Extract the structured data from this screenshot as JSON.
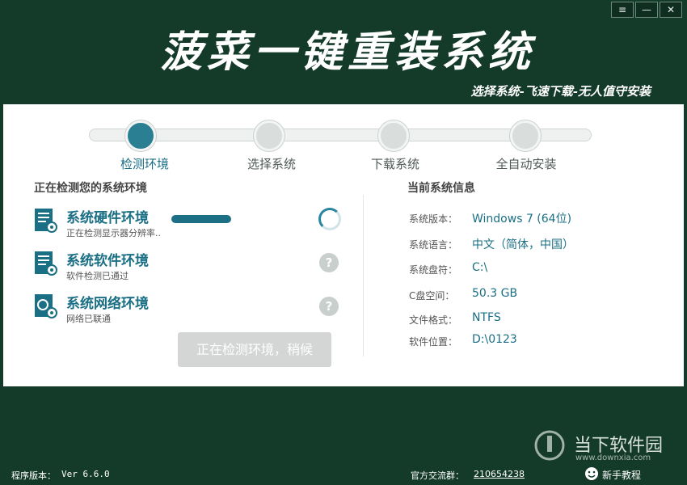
{
  "window": {
    "menu_glyph": "≡",
    "min_glyph": "—",
    "close_glyph": "✕"
  },
  "header": {
    "title": "菠菜一键重装系统",
    "slogan": "选择系统-飞速下载-无人值守安装"
  },
  "steps": [
    {
      "label": "检测环境",
      "active": true
    },
    {
      "label": "选择系统",
      "active": false
    },
    {
      "label": "下载系统",
      "active": false
    },
    {
      "label": "全自动安装",
      "active": false
    }
  ],
  "left": {
    "title": "正在检测您的系统环境",
    "items": [
      {
        "name": "系统硬件环境",
        "sub": "正在检测显示器分辨率..",
        "icon": "hardware-check-icon"
      },
      {
        "name": "系统软件环境",
        "sub": "软件检测已通过",
        "icon": "software-check-icon"
      },
      {
        "name": "系统网络环境",
        "sub": "网络已联通",
        "icon": "network-check-icon"
      }
    ],
    "unknown_glyph": "?",
    "wait_button": "正在检测环境，稍候"
  },
  "right": {
    "title": "当前系统信息",
    "rows": [
      {
        "label": "系统版本：",
        "value": "Windows 7 (64位)"
      },
      {
        "label": "系统语言：",
        "value": "中文（简体，中国）"
      },
      {
        "label": "系统盘符：",
        "value": "C:\\"
      },
      {
        "label": "C盘空间：",
        "value": "50.3 GB"
      },
      {
        "label": "文件格式：",
        "value": "NTFS"
      },
      {
        "label": "软件位置：",
        "value": "D:\\0123"
      }
    ]
  },
  "footer": {
    "version_label": "程序版本：",
    "version_value": "Ver 6.6.0",
    "group_label": "官方交流群：",
    "group_value": "210654238",
    "tutorial": "新手教程"
  },
  "watermark": {
    "cn": "当下软件园",
    "en": "www.downxia.com"
  },
  "colors": {
    "background": "#143a2a",
    "accent": "#1b6f85",
    "inactive": "#d9dedc"
  }
}
